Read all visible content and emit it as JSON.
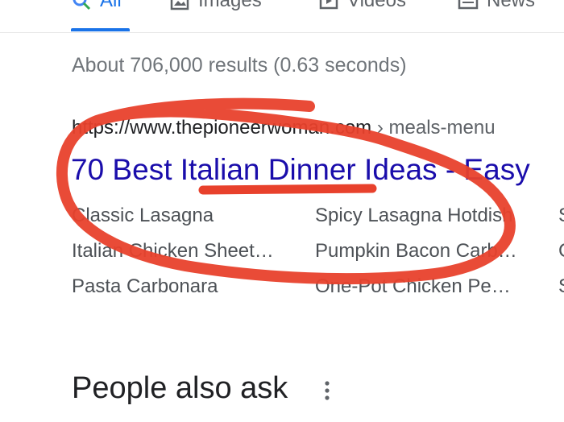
{
  "tabs": [
    {
      "label": "All",
      "icon": "search-icon",
      "active": true
    },
    {
      "label": "Images",
      "icon": "image-icon"
    },
    {
      "label": "Videos",
      "icon": "video-icon"
    },
    {
      "label": "News",
      "icon": "news-icon"
    }
  ],
  "stats": "About 706,000 results (0.63 seconds)",
  "result": {
    "url_domain": "https://www.thepioneerwoman.com",
    "url_path": " › meals-menu",
    "title": "70 Best Italian Dinner Ideas - Easy",
    "sitelinks": [
      [
        "Classic Lasagna",
        "Spicy Lasagna Hotdish",
        "S"
      ],
      [
        "Italian Chicken Sheet…",
        "Pumpkin Bacon Carb…",
        "C"
      ],
      [
        "Pasta Carbonara",
        "One-Pot Chicken Pe…",
        "S"
      ]
    ]
  },
  "people_also_ask": "People also ask",
  "colors": {
    "accent": "#1a73e8",
    "link": "#1a0dab",
    "annotation": "#e8412c"
  }
}
